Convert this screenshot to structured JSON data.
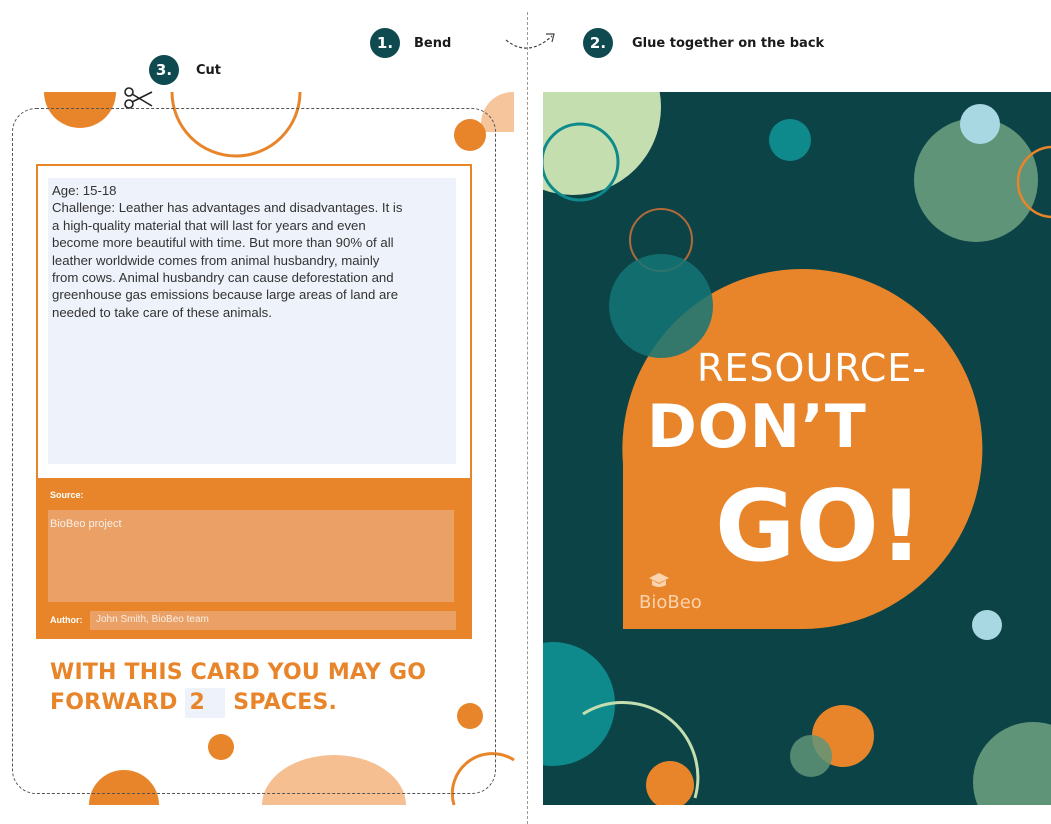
{
  "steps": [
    {
      "number": "1.",
      "label": "Bend"
    },
    {
      "number": "2.",
      "label": "Glue together on the back"
    },
    {
      "number": "3.",
      "label": "Cut"
    }
  ],
  "card": {
    "challenge_lines": [
      "Age: 15-18",
      "Challenge: Leather has advantages and disadvantages. It is",
      "a high-quality material that will last for years and even",
      "become more beautiful with time. But more than 90% of all",
      "leather worldwide comes from animal husbandry, mainly",
      "from cows. Animal husbandry can cause deforestation and",
      "greenhouse gas emissions because large areas of land are",
      "needed to take care of these animals."
    ],
    "source_label": "Source:",
    "source_value": "BioBeo project",
    "author_label": "Author:",
    "author_value": "John Smith, BioBeo team",
    "forward_line1": "WITH THIS CARD YOU MAY GO",
    "forward_prefix": "FORWARD",
    "forward_number": "2",
    "forward_suffix": "SPACES."
  },
  "back": {
    "line1": "RESOURCE-",
    "line2": "DON’T",
    "line3": "GO!",
    "logo": "BioBeo"
  },
  "colors": {
    "orange": "#e8852a",
    "dark_teal": "#0c4347",
    "teal": "#0e8a8c",
    "light_green": "#c5deb0",
    "sage": "#5f9478",
    "light_blue": "#a8d8e2",
    "peach": "#f5bf91"
  },
  "icons": [
    "scissors-icon",
    "curved-arrow-icon",
    "biobeo-logo-icon"
  ]
}
